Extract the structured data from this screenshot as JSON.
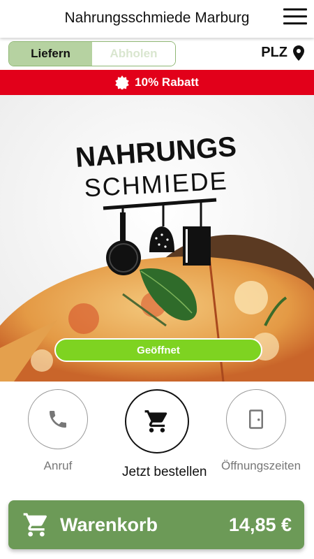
{
  "header": {
    "title": "Nahrungsschmiede Marburg",
    "menu_icon": "hamburger-menu-icon"
  },
  "delivery_toggle": {
    "options": [
      "Liefern",
      "Abholen"
    ],
    "selected": "Liefern"
  },
  "postcode": {
    "label": "PLZ",
    "icon": "location-pin-icon"
  },
  "promo": {
    "text": "10% Rabatt",
    "icon": "badge-icon",
    "color": "#e2001a"
  },
  "hero": {
    "logo_line1": "NAHRUNGS",
    "logo_line2": "SCHMIEDE",
    "status": "Geöffnet",
    "status_color": "#7ed321"
  },
  "actions": [
    {
      "label": "Anruf",
      "icon": "phone-icon"
    },
    {
      "label": "Jetzt bestellen",
      "icon": "shopping-cart-icon"
    },
    {
      "label": "Öffnungszeiten",
      "icon": "door-icon"
    }
  ],
  "cart": {
    "label": "Warenkorb",
    "total": "14,85 €",
    "icon": "shopping-cart-icon",
    "color": "#6c9a57"
  }
}
